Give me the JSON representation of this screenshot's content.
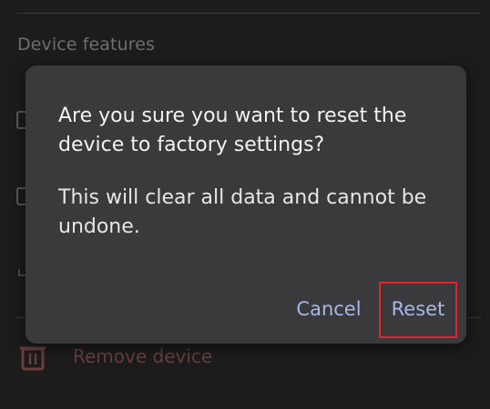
{
  "background": {
    "section_title": "Device features",
    "remove_device_label": "Remove device"
  },
  "dialog": {
    "title": "Are you sure you want to reset the device to factory settings?",
    "message": "This will clear all data and cannot be undone.",
    "cancel_label": "Cancel",
    "reset_label": "Reset"
  },
  "colors": {
    "background": "#1c1c1d",
    "dialog_surface": "#3a3a3c",
    "button_text": "#a8b6ea",
    "highlight": "#e3232b",
    "destructive_muted": "#6b3f3b"
  },
  "icons": {
    "remove_device": "trash-icon"
  }
}
